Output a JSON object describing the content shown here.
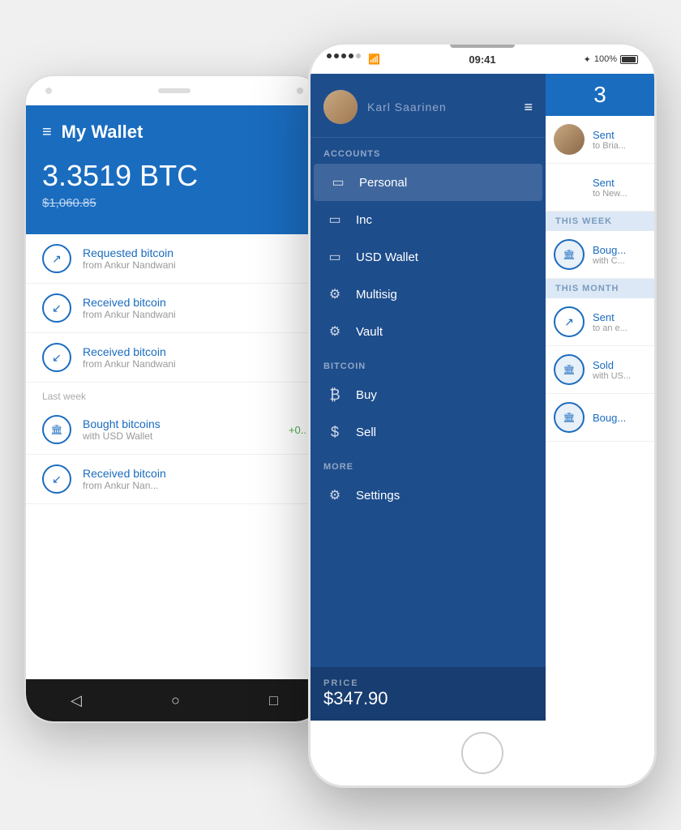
{
  "android": {
    "wallet_title": "My Wallet",
    "btc_balance": "3.3519 BTC",
    "usd_balance": "$1,060.85",
    "transactions": [
      {
        "type": "requested",
        "title": "Requested bitcoin",
        "sub": "from Ankur Nandwani",
        "icon": "↗"
      },
      {
        "type": "received",
        "title": "Received bitcoin",
        "sub": "from Ankur Nandwani",
        "icon": "↙"
      },
      {
        "type": "received",
        "title": "Received bitcoin",
        "sub": "from Ankur Nandwani",
        "icon": "↙"
      }
    ],
    "section_label": "Last week",
    "last_week_transactions": [
      {
        "type": "bought",
        "title": "Bought bitcoins",
        "sub": "with USD Wallet",
        "amount": "+0..",
        "icon": "🏛"
      },
      {
        "type": "received",
        "title": "Received bitcoin",
        "sub": "from Ankur Nan...",
        "icon": "↙"
      }
    ]
  },
  "ios": {
    "status_bar": {
      "dots": [
        "•",
        "•",
        "•",
        "•",
        "•"
      ],
      "wifi": "WiFi",
      "time": "09:41",
      "bluetooth": "BT",
      "battery_percent": "100%"
    },
    "profile_name": "Karl Saarinen",
    "drawer": {
      "accounts_label": "ACCOUNTS",
      "accounts": [
        {
          "label": "Personal",
          "icon": "▭",
          "active": true
        },
        {
          "label": "Inc",
          "icon": "▭",
          "active": false
        },
        {
          "label": "USD Wallet",
          "icon": "▭",
          "active": false
        },
        {
          "label": "Multisig",
          "icon": "⚙",
          "active": false
        },
        {
          "label": "Vault",
          "icon": "⚙",
          "active": false
        }
      ],
      "bitcoin_label": "BITCOIN",
      "bitcoin": [
        {
          "label": "Buy",
          "icon": "₿"
        },
        {
          "label": "Sell",
          "icon": "$"
        }
      ],
      "more_label": "MORE",
      "more": [
        {
          "label": "Settings",
          "icon": "⚙"
        }
      ],
      "price_label": "PRICE",
      "price_value": "$347.90"
    },
    "right_panel": {
      "balance": "3",
      "transactions": [
        {
          "section": "",
          "title": "Sent",
          "sub": "to Bria...",
          "type": "person",
          "avatar": 1
        },
        {
          "section": "",
          "title": "Sent",
          "sub": "to New...",
          "type": "person",
          "avatar": 2
        },
        {
          "section": "THIS WEEK",
          "title": "Boug...",
          "sub": "with C...",
          "type": "bank"
        },
        {
          "section": "THIS MONTH",
          "title": "Sent",
          "sub": "to an e...",
          "type": "send"
        },
        {
          "section": "",
          "title": "Sold",
          "sub": "with US...",
          "type": "bank"
        },
        {
          "section": "",
          "title": "Boug...",
          "sub": "",
          "type": "bank"
        }
      ]
    }
  }
}
